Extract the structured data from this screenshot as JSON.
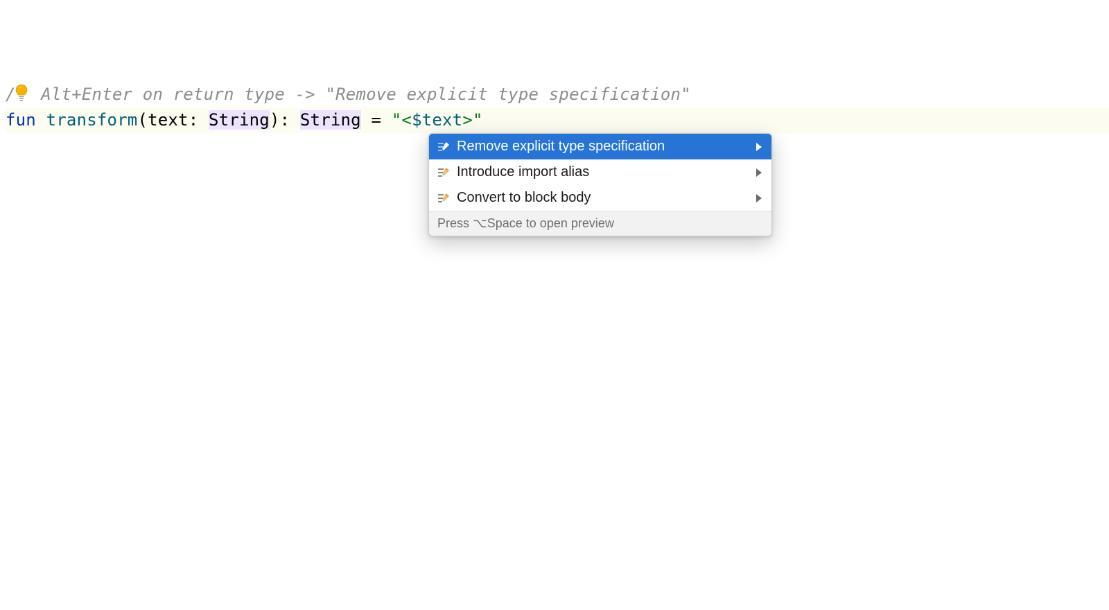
{
  "code": {
    "comment_prefix": "/",
    "comment_rest": " Alt+Enter on return type -> \"Remove explicit type specification\"",
    "keyword_fun": "fun",
    "func_name": "transform",
    "open_paren": "(",
    "param_name": "text",
    "colon1": ": ",
    "param_type": "String",
    "close_paren": ")",
    "colon2": ": ",
    "return_type": "String",
    "equals": " = ",
    "string_open": "\"",
    "string_lt": "<",
    "string_interp": "$text",
    "string_gt": ">",
    "string_close": "\""
  },
  "popup": {
    "items": [
      {
        "label": "Remove explicit type specification",
        "selected": true,
        "has_arrow": true
      },
      {
        "label": "Introduce import alias",
        "selected": false,
        "has_arrow": true
      },
      {
        "label": "Convert to block body",
        "selected": false,
        "has_arrow": true
      }
    ],
    "footer": "Press ⌥Space to open preview"
  },
  "colors": {
    "selection_bg": "#2675d6",
    "highlight_bg": "#fdfcf1",
    "usage_bg": "#ede3fc",
    "comment": "#8c8c8c",
    "keyword": "#0033b3",
    "func": "#00627A",
    "string": "#067D17"
  }
}
